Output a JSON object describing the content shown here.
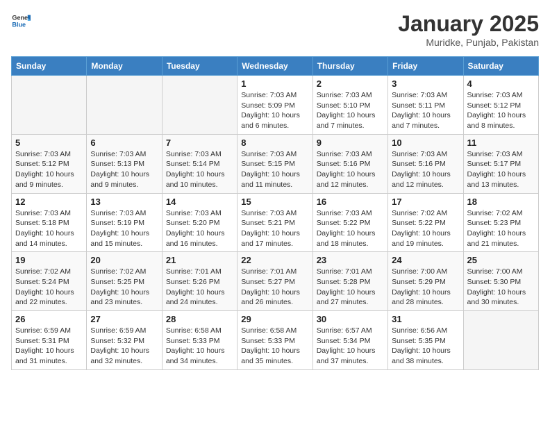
{
  "header": {
    "logo_general": "General",
    "logo_blue": "Blue",
    "title": "January 2025",
    "subtitle": "Muridke, Punjab, Pakistan"
  },
  "weekdays": [
    "Sunday",
    "Monday",
    "Tuesday",
    "Wednesday",
    "Thursday",
    "Friday",
    "Saturday"
  ],
  "weeks": [
    [
      {
        "day": "",
        "info": ""
      },
      {
        "day": "",
        "info": ""
      },
      {
        "day": "",
        "info": ""
      },
      {
        "day": "1",
        "info": "Sunrise: 7:03 AM\nSunset: 5:09 PM\nDaylight: 10 hours\nand 6 minutes."
      },
      {
        "day": "2",
        "info": "Sunrise: 7:03 AM\nSunset: 5:10 PM\nDaylight: 10 hours\nand 7 minutes."
      },
      {
        "day": "3",
        "info": "Sunrise: 7:03 AM\nSunset: 5:11 PM\nDaylight: 10 hours\nand 7 minutes."
      },
      {
        "day": "4",
        "info": "Sunrise: 7:03 AM\nSunset: 5:12 PM\nDaylight: 10 hours\nand 8 minutes."
      }
    ],
    [
      {
        "day": "5",
        "info": "Sunrise: 7:03 AM\nSunset: 5:12 PM\nDaylight: 10 hours\nand 9 minutes."
      },
      {
        "day": "6",
        "info": "Sunrise: 7:03 AM\nSunset: 5:13 PM\nDaylight: 10 hours\nand 9 minutes."
      },
      {
        "day": "7",
        "info": "Sunrise: 7:03 AM\nSunset: 5:14 PM\nDaylight: 10 hours\nand 10 minutes."
      },
      {
        "day": "8",
        "info": "Sunrise: 7:03 AM\nSunset: 5:15 PM\nDaylight: 10 hours\nand 11 minutes."
      },
      {
        "day": "9",
        "info": "Sunrise: 7:03 AM\nSunset: 5:16 PM\nDaylight: 10 hours\nand 12 minutes."
      },
      {
        "day": "10",
        "info": "Sunrise: 7:03 AM\nSunset: 5:16 PM\nDaylight: 10 hours\nand 12 minutes."
      },
      {
        "day": "11",
        "info": "Sunrise: 7:03 AM\nSunset: 5:17 PM\nDaylight: 10 hours\nand 13 minutes."
      }
    ],
    [
      {
        "day": "12",
        "info": "Sunrise: 7:03 AM\nSunset: 5:18 PM\nDaylight: 10 hours\nand 14 minutes."
      },
      {
        "day": "13",
        "info": "Sunrise: 7:03 AM\nSunset: 5:19 PM\nDaylight: 10 hours\nand 15 minutes."
      },
      {
        "day": "14",
        "info": "Sunrise: 7:03 AM\nSunset: 5:20 PM\nDaylight: 10 hours\nand 16 minutes."
      },
      {
        "day": "15",
        "info": "Sunrise: 7:03 AM\nSunset: 5:21 PM\nDaylight: 10 hours\nand 17 minutes."
      },
      {
        "day": "16",
        "info": "Sunrise: 7:03 AM\nSunset: 5:22 PM\nDaylight: 10 hours\nand 18 minutes."
      },
      {
        "day": "17",
        "info": "Sunrise: 7:02 AM\nSunset: 5:22 PM\nDaylight: 10 hours\nand 19 minutes."
      },
      {
        "day": "18",
        "info": "Sunrise: 7:02 AM\nSunset: 5:23 PM\nDaylight: 10 hours\nand 21 minutes."
      }
    ],
    [
      {
        "day": "19",
        "info": "Sunrise: 7:02 AM\nSunset: 5:24 PM\nDaylight: 10 hours\nand 22 minutes."
      },
      {
        "day": "20",
        "info": "Sunrise: 7:02 AM\nSunset: 5:25 PM\nDaylight: 10 hours\nand 23 minutes."
      },
      {
        "day": "21",
        "info": "Sunrise: 7:01 AM\nSunset: 5:26 PM\nDaylight: 10 hours\nand 24 minutes."
      },
      {
        "day": "22",
        "info": "Sunrise: 7:01 AM\nSunset: 5:27 PM\nDaylight: 10 hours\nand 26 minutes."
      },
      {
        "day": "23",
        "info": "Sunrise: 7:01 AM\nSunset: 5:28 PM\nDaylight: 10 hours\nand 27 minutes."
      },
      {
        "day": "24",
        "info": "Sunrise: 7:00 AM\nSunset: 5:29 PM\nDaylight: 10 hours\nand 28 minutes."
      },
      {
        "day": "25",
        "info": "Sunrise: 7:00 AM\nSunset: 5:30 PM\nDaylight: 10 hours\nand 30 minutes."
      }
    ],
    [
      {
        "day": "26",
        "info": "Sunrise: 6:59 AM\nSunset: 5:31 PM\nDaylight: 10 hours\nand 31 minutes."
      },
      {
        "day": "27",
        "info": "Sunrise: 6:59 AM\nSunset: 5:32 PM\nDaylight: 10 hours\nand 32 minutes."
      },
      {
        "day": "28",
        "info": "Sunrise: 6:58 AM\nSunset: 5:33 PM\nDaylight: 10 hours\nand 34 minutes."
      },
      {
        "day": "29",
        "info": "Sunrise: 6:58 AM\nSunset: 5:33 PM\nDaylight: 10 hours\nand 35 minutes."
      },
      {
        "day": "30",
        "info": "Sunrise: 6:57 AM\nSunset: 5:34 PM\nDaylight: 10 hours\nand 37 minutes."
      },
      {
        "day": "31",
        "info": "Sunrise: 6:56 AM\nSunset: 5:35 PM\nDaylight: 10 hours\nand 38 minutes."
      },
      {
        "day": "",
        "info": ""
      }
    ]
  ]
}
